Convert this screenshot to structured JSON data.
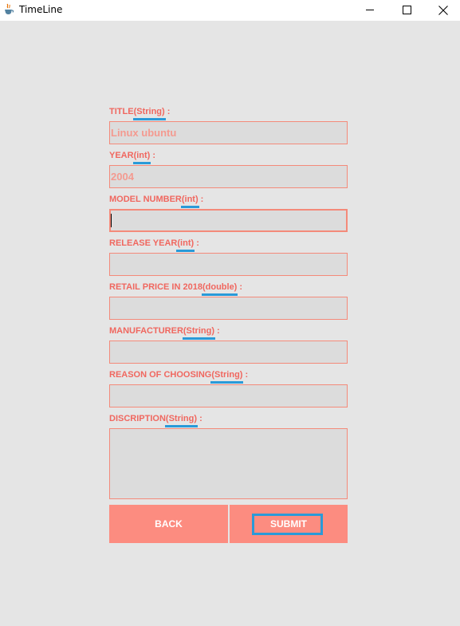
{
  "window": {
    "title": "TimeLine"
  },
  "form": {
    "fields": [
      {
        "label": "TITLE",
        "type": "(String)",
        "suffix": " :",
        "value": "Linux ubuntu"
      },
      {
        "label": "YEAR",
        "type": "(int)",
        "suffix": " :",
        "value": "2004"
      },
      {
        "label": "MODEL NUMBER",
        "type": "(int)",
        "suffix": " :",
        "value": ""
      },
      {
        "label": "RELEASE YEAR",
        "type": "(int)",
        "suffix": " :",
        "value": ""
      },
      {
        "label": "RETAIL PRICE IN 2018",
        "type": "(double)",
        "suffix": " :",
        "value": ""
      },
      {
        "label": "MANUFACTURER",
        "type": "(String)",
        "suffix": " :",
        "value": ""
      },
      {
        "label": "REASON OF CHOOSING",
        "type": "(String)",
        "suffix": " :",
        "value": ""
      },
      {
        "label": "DISCRIPTION",
        "type": "(String)",
        "suffix": " :",
        "value": ""
      }
    ],
    "back_label": "BACK",
    "submit_label": "SUBMIT"
  },
  "colors": {
    "background": "#e5e5e5",
    "label": "#f0675f",
    "button": "#fc8c80",
    "focus": "#2a9ad8",
    "input_bg": "#dcdcdc",
    "input_border": "#f48a7a"
  },
  "icons": {
    "app": "java-cup-icon",
    "minimize": "minimize-icon",
    "maximize": "maximize-icon",
    "close": "close-icon"
  }
}
